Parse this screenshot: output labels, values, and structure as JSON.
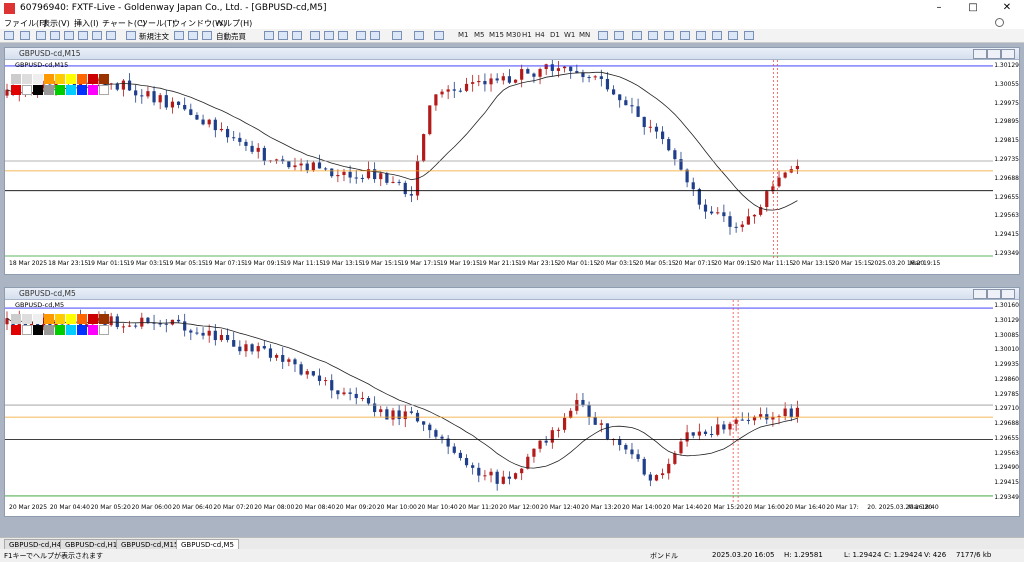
{
  "window": {
    "title": "60796940: FXTF-Live - Goldenway Japan Co., Ltd. - [GBPUSD-cd,M5]"
  },
  "menu": [
    "ファイル(F)",
    "表示(V)",
    "挿入(I)",
    "チャート(C)",
    "ツール(T)",
    "ウィンドウ(W)",
    "ヘルプ(H)"
  ],
  "toolbar": {
    "new_order": "新規注文",
    "auto_trade": "自動売買",
    "timeframes": [
      "M1",
      "M5",
      "M15",
      "M30",
      "H1",
      "H4",
      "D1",
      "W1",
      "MN"
    ]
  },
  "charts": [
    {
      "title": "GBPUSD-cd,M15",
      "symbol_label": "GBPUSD-cd,M15",
      "price_labels": [
        "1.30129",
        "1.30055",
        "1.29975",
        "1.29895",
        "1.29815",
        "1.29735",
        "1.29688",
        "1.29655",
        "1.29563",
        "1.29415",
        "1.29349"
      ],
      "time_labels": [
        "18 Mar 2025",
        "18 Mar 23:15",
        "19 Mar 01:15",
        "19 Mar 03:15",
        "19 Mar 05:15",
        "19 Mar 07:15",
        "19 Mar 09:15",
        "19 Mar 11:15",
        "19 Mar 13:15",
        "19 Mar 15:15",
        "19 Mar 17:15",
        "19 Mar 19:15",
        "19 Mar 21:15",
        "19 Mar 23:15",
        "20 Mar 01:15",
        "20 Mar 03:15",
        "20 Mar 05:15",
        "20 Mar 07:15",
        "20 Mar 09:15",
        "20 Mar 11:15",
        "20 Mar 13:15",
        "20 Mar 15:15",
        "2025.03.20 16:20",
        "Mar 19:15"
      ]
    },
    {
      "title": "GBPUSD-cd,M5",
      "symbol_label": "GBPUSD-cd,M5",
      "price_labels": [
        "1.30160",
        "1.30129",
        "1.30085",
        "1.30010",
        "1.29935",
        "1.29860",
        "1.29785",
        "1.29710",
        "1.29688",
        "1.29655",
        "1.29563",
        "1.29490",
        "1.29415",
        "1.29349"
      ],
      "time_labels": [
        "20 Mar 2025",
        "20 Mar 04:40",
        "20 Mar 05:20",
        "20 Mar 06:00",
        "20 Mar 06:40",
        "20 Mar 07:20",
        "20 Mar 08:00",
        "20 Mar 08:40",
        "20 Mar 09:20",
        "20 Mar 10:00",
        "20 Mar 10:40",
        "20 Mar 11:20",
        "20 Mar 12:00",
        "20 Mar 12:40",
        "20 Mar 13:20",
        "20 Mar 14:00",
        "20 Mar 14:40",
        "20 Mar 15:20",
        "20 Mar 16:00",
        "20 Mar 16:40",
        "20 Mar 17:",
        "20. 2025.03.20 16:20",
        "Mar 18:40"
      ]
    }
  ],
  "colors": {
    "bull": "#b31a1a",
    "bear": "#1f3f8a",
    "ma": "#222222",
    "blue_line": "#2a2aff",
    "orange_line": "#f0a020",
    "gray_line": "#9a9a9a",
    "red_vline": "#ff3030"
  },
  "tabs": [
    "GBPUSD-cd,H4",
    "GBPUSD-cd,H1",
    "GBPUSD-cd,M15",
    "GBPUSD-cd,M5"
  ],
  "status": {
    "help": "F1キーでヘルプが表示されます",
    "profile": "ボンドル",
    "time": "2025.03.20 16:05",
    "high": "H: 1.29581",
    "low": "L: 1.29424",
    "close": "C: 1.29424",
    "volume": "V: 426",
    "traffic": "7177/6 kb"
  }
}
